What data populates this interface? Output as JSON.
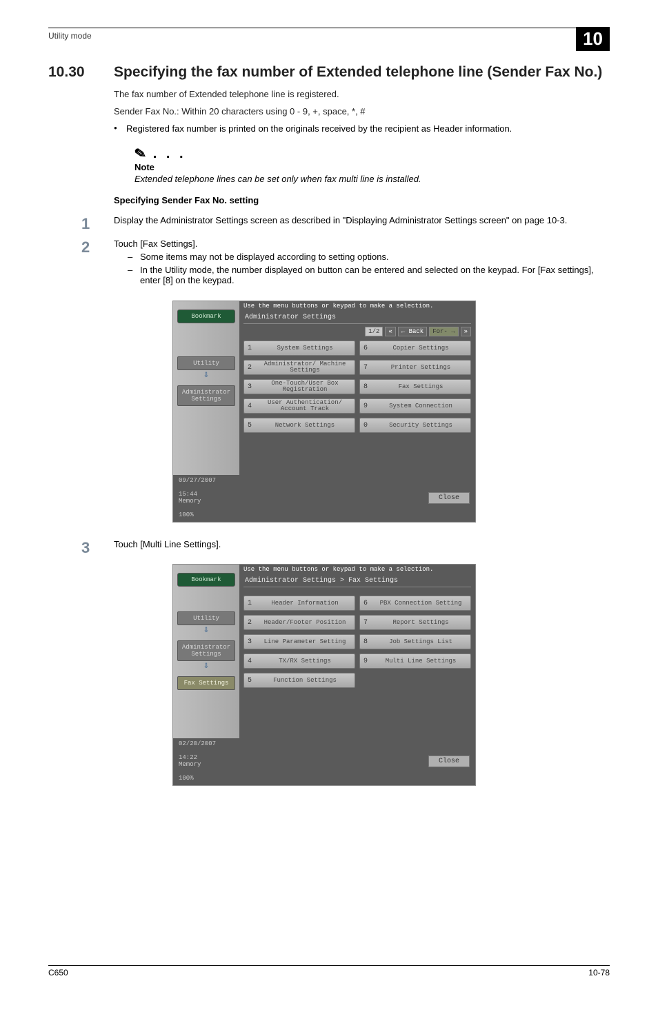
{
  "header": {
    "running": "Utility mode",
    "chapter_no": "10"
  },
  "section": {
    "number": "10.30",
    "title": "Specifying the fax number of Extended telephone line (Sender Fax No.)"
  },
  "intro": [
    "The fax number of Extended telephone line is registered.",
    "Sender Fax No.: Within 20 characters using 0 - 9, +, space, *, #"
  ],
  "bullets": [
    "Registered fax number is printed on the originals received by the recipient as Header information."
  ],
  "note": {
    "label": "Note",
    "text": "Extended telephone lines can be set only when fax multi line is installed."
  },
  "subhead": "Specifying Sender Fax No. setting",
  "steps": [
    {
      "n": "1",
      "text": "Display the Administrator Settings screen as described in \"Displaying Administrator Settings screen\" on page 10-3."
    },
    {
      "n": "2",
      "text": "Touch [Fax Settings]."
    },
    {
      "n": "3",
      "text": "Touch [Multi Line Settings]."
    }
  ],
  "step2_sub": [
    "Some items may not be displayed according to setting options.",
    "In the Utility mode, the number displayed on button can be entered and selected on the keypad. For [Fax settings], enter [8] on the keypad."
  ],
  "screen_common": {
    "hint": "Use the menu buttons or keypad to make a selection.",
    "sidebar": {
      "bookmark": "Bookmark",
      "utility": "Utility",
      "admin": "Administrator Settings",
      "fax": "Fax Settings"
    },
    "close": "Close"
  },
  "screen1": {
    "breadcrumb": "Administrator Settings",
    "page_ind": "1/2",
    "back": "← Back",
    "fwd": "For- →",
    "left": [
      {
        "n": "1",
        "lbl": "System Settings"
      },
      {
        "n": "2",
        "lbl": "Administrator/\nMachine Settings"
      },
      {
        "n": "3",
        "lbl": "One-Touch/User Box\nRegistration"
      },
      {
        "n": "4",
        "lbl": "User Authentication/\nAccount Track"
      },
      {
        "n": "5",
        "lbl": "Network Settings"
      }
    ],
    "right": [
      {
        "n": "6",
        "lbl": "Copier Settings"
      },
      {
        "n": "7",
        "lbl": "Printer Settings"
      },
      {
        "n": "8",
        "lbl": "Fax Settings"
      },
      {
        "n": "9",
        "lbl": "System Connection"
      },
      {
        "n": "0",
        "lbl": "Security Settings"
      }
    ],
    "footer": {
      "date": "09/27/2007",
      "time": "15:44",
      "mem": "Memory",
      "memval": "100%"
    }
  },
  "screen2": {
    "breadcrumb": "Administrator Settings  >  Fax Settings",
    "left": [
      {
        "n": "1",
        "lbl": "Header\nInformation"
      },
      {
        "n": "2",
        "lbl": "Header/Footer\nPosition"
      },
      {
        "n": "3",
        "lbl": "Line Parameter Setting"
      },
      {
        "n": "4",
        "lbl": "TX/RX Settings"
      },
      {
        "n": "5",
        "lbl": "Function Settings"
      }
    ],
    "right": [
      {
        "n": "6",
        "lbl": "PBX Connection\nSetting"
      },
      {
        "n": "7",
        "lbl": "Report Settings"
      },
      {
        "n": "8",
        "lbl": "Job Settings\nList"
      },
      {
        "n": "9",
        "lbl": "Multi Line\nSettings"
      }
    ],
    "footer": {
      "date": "02/20/2007",
      "time": "14:22",
      "mem": "Memory",
      "memval": "100%"
    }
  },
  "pagefoot": {
    "left": "C650",
    "right": "10-78"
  }
}
